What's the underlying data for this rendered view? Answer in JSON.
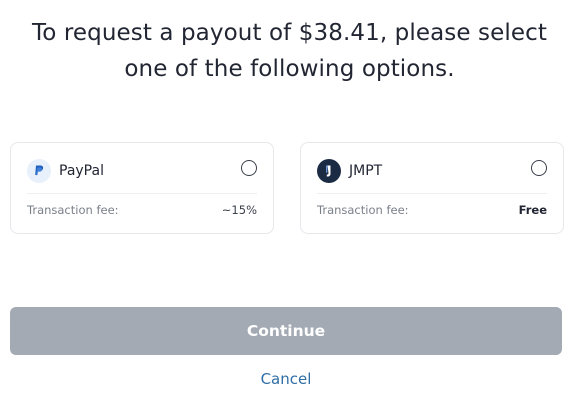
{
  "heading": {
    "line1": "To request a payout of $38.41, please select",
    "line2": "one of the following options."
  },
  "options": [
    {
      "name": "PayPal",
      "fee_label": "Transaction fee:",
      "fee_value": "~15%",
      "selected": false,
      "icon": "paypal-logo-icon",
      "brand_color": "#1f5fbf"
    },
    {
      "name": "JMPT",
      "fee_label": "Transaction fee:",
      "fee_value": "Free",
      "selected": false,
      "icon": "jmpt-logo-icon",
      "brand_color": "#1b2b44"
    }
  ],
  "actions": {
    "continue_label": "Continue",
    "cancel_label": "Cancel"
  },
  "colors": {
    "continue_bg_disabled": "#a3aab3",
    "cancel_link": "#2f6ea6"
  }
}
